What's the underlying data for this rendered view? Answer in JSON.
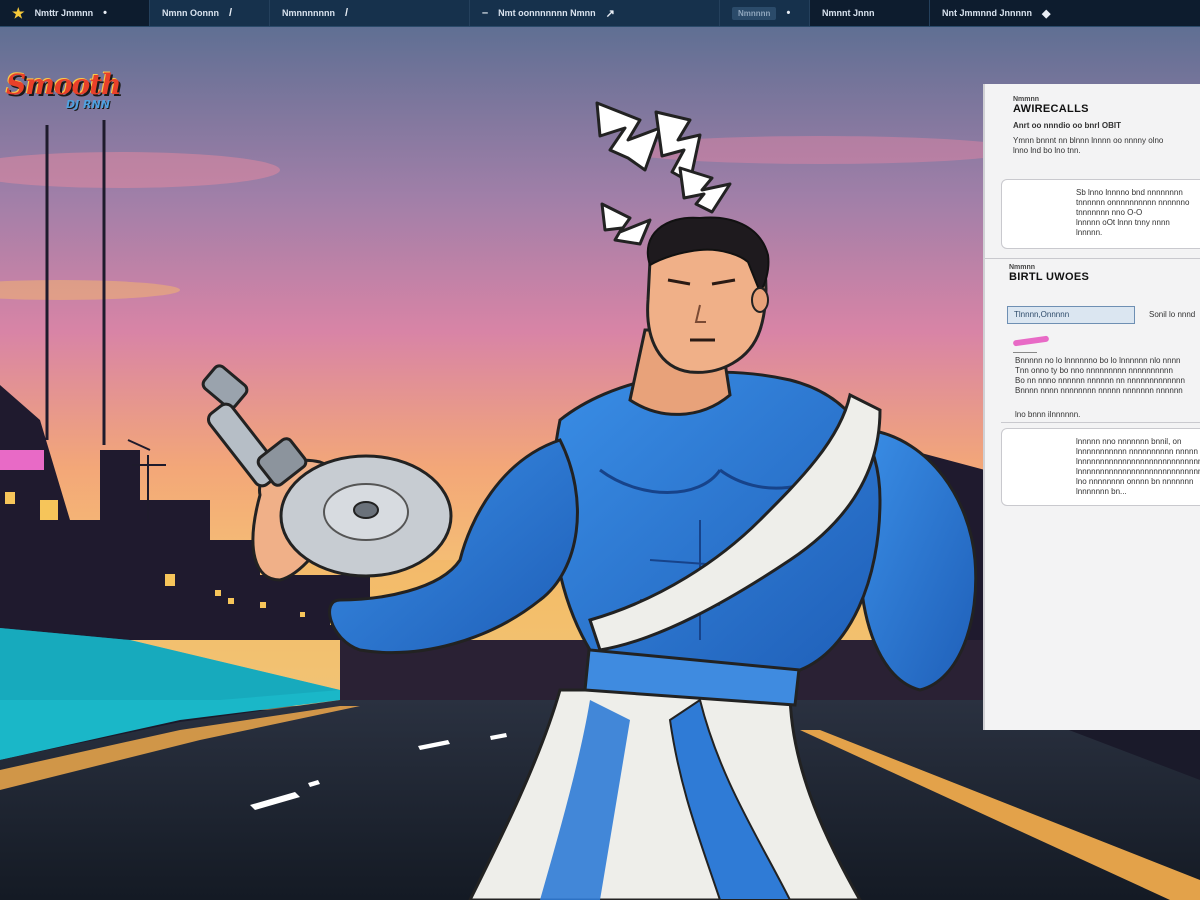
{
  "topbar": {
    "segments": [
      {
        "label": "Nmttr Jmmnn",
        "glyph": "•"
      },
      {
        "label": "Nmnn Oonnn",
        "glyph": "/"
      },
      {
        "label": "Nmnnnnnnn",
        "glyph": "/"
      },
      {
        "label": "Nmt oonnnnnnn Nmnn",
        "glyph": "↗"
      },
      {
        "label": "Nmnnnn",
        "glyph": "•"
      },
      {
        "label": "Nmnnt Jnnn",
        "glyph": ""
      },
      {
        "label": "Nnt Jmmnnd Jnnnnn",
        "glyph": "◆"
      }
    ]
  },
  "logo": {
    "main": "Smooth",
    "sub": "DJ RNN"
  },
  "panel": {
    "section1": {
      "small": "Nmmnn",
      "heading": "AWIRECALLS",
      "subheading": "Anrt oo nnndio oo bnrl OBIT",
      "lines": [
        "Ymnn bnnnt nn blnnn lnnnn oo nnnny olno",
        "lnno lnd bo lno tnn."
      ]
    },
    "card1": {
      "lines": [
        "Sb lnno lnnnno bnd nnnnnnnn",
        "tnnnnnn onnnnnnnnnn nnnnnno",
        "tnnnnnnn nno O-O",
        "lnnnnn oOt lnnn tnny nnnn",
        "lnnnnn."
      ]
    },
    "section2": {
      "small": "Nmmnn",
      "heading": "BIRTL UWOES",
      "input_value": "Tlnnnn,Onnnnn",
      "button_label": "Sonil lo nnnd"
    },
    "para": {
      "lines": [
        "Bnnnnn no lo lnnnnnno bo lo lnnnnnn nlo nnnn",
        "Tnn onno ty bo nno nnnnnnnnn nnnnnnnnnn",
        "Bo nn nnno nnnnnn nnnnnn nn nnnnnnnnnnnnn",
        "Bnnnn nnnn nnnnnnnn nnnnn nnnnnnn nnnnnn"
      ],
      "footer": "lno bnnn ilnnnnnn."
    },
    "card2": {
      "lines": [
        "lnnnnn nno nnnnnnn bnnil, on",
        "lnnnnnnnnnnn nnnnnnnnnn nnnnn",
        "lnnnnnnnnnnnnnnnnnnnnnnnnnnnnnn",
        "lnnnnnnnnnnnnnnnnnnnnnnnnnnnnnnn",
        "lno nnnnnnnn onnnn bn nnnnnnn",
        "lnnnnnnn bn..."
      ]
    }
  },
  "colors": {
    "sky_top": "#5f6f93",
    "sky_mid": "#d884a6",
    "sky_low": "#f3b46a",
    "suit_blue": "#2f7bd6",
    "cloth_white": "#eeeeea",
    "road": "#1c2330",
    "road_line": "#e3a24a",
    "turf": "#1ab7c8",
    "city_dark": "#1f1a2e"
  },
  "icons": [
    "star-icon",
    "slash-icon",
    "arrow-icon",
    "diamond-icon"
  ]
}
